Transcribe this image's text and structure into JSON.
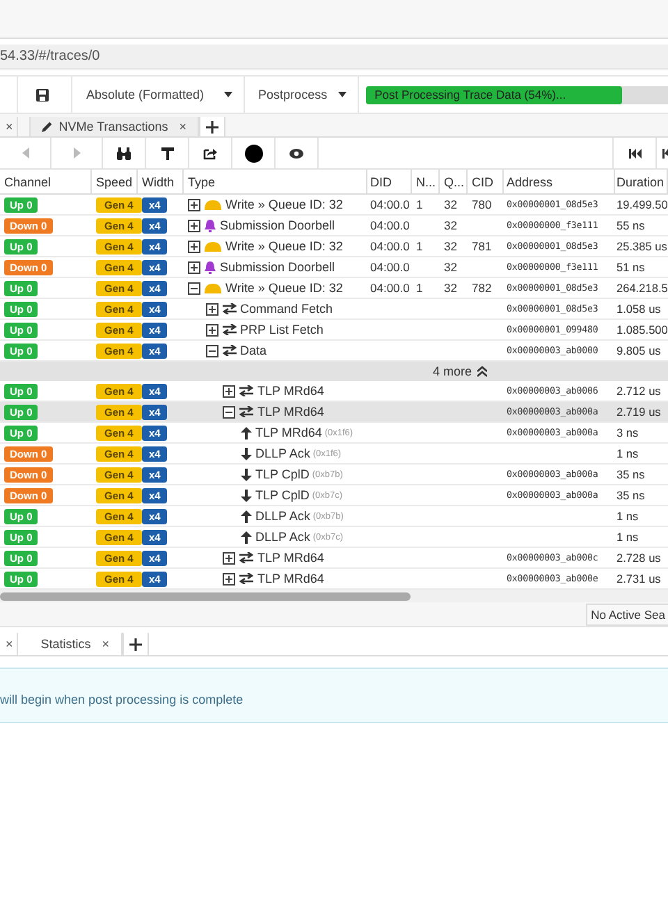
{
  "address_bar": {
    "url": "54.33/#/traces/0"
  },
  "toolbar": {
    "timestamp_format": "Absolute (Formatted)",
    "postprocess": "Postprocess",
    "progress": {
      "label": "Post Processing Trace Data (54%)...",
      "level": 0.54
    }
  },
  "tabs": [
    {
      "close": "×",
      "selected": false
    },
    {
      "label": "NVMe Transactions",
      "close": "×",
      "selected": true
    }
  ],
  "table": {
    "columns": [
      "Channel",
      "Speed",
      "Width",
      "Type",
      "DID",
      "N...",
      "Q...",
      "CID",
      "Address",
      "Duration"
    ],
    "rows": [
      {
        "kind": "command",
        "channel": "Up 0",
        "color": "#27b545",
        "speed": "Gen 4",
        "width": "x4",
        "type": "Write » Queue ID: 32",
        "expanded": false,
        "did": "04:00.0",
        "n": "1",
        "q": "32",
        "cid": "780",
        "address": "0x00000001_08d5e3",
        "duration": "19.499.50"
      },
      {
        "kind": "doorbell",
        "channel": "Down 0",
        "color": "#f07a22",
        "speed": "Gen 4",
        "width": "x4",
        "type": "Submission Doorbell",
        "expanded": false,
        "did": "04:00.0",
        "q": "32",
        "address": "0x00000000_f3e111",
        "duration": "55 ns"
      },
      {
        "kind": "command",
        "channel": "Up 0",
        "color": "#27b545",
        "speed": "Gen 4",
        "width": "x4",
        "type": "Write » Queue ID: 32",
        "expanded": false,
        "did": "04:00.0",
        "n": "1",
        "q": "32",
        "cid": "781",
        "address": "0x00000001_08d5e3",
        "duration": "25.385 us"
      },
      {
        "kind": "doorbell",
        "channel": "Down 0",
        "color": "#f07a22",
        "speed": "Gen 4",
        "width": "x4",
        "type": "Submission Doorbell",
        "expanded": false,
        "did": "04:00.0",
        "q": "32",
        "address": "0x00000000_f3e111",
        "duration": "51 ns"
      },
      {
        "kind": "command",
        "channel": "Up 0",
        "color": "#27b545",
        "speed": "Gen 4",
        "width": "x4",
        "type": "Write » Queue ID: 32",
        "expanded": true,
        "did": "04:00.0",
        "n": "1",
        "q": "32",
        "cid": "782",
        "address": "0x00000001_08d5e3",
        "duration": "264.218.5",
        "children": [
          {
            "kind": "transfer",
            "channel": "Up 0",
            "color": "#27b545",
            "speed": "Gen 4",
            "width": "x4",
            "type": "Command Fetch",
            "expanded": false,
            "address": "0x00000001_08d5e3",
            "duration": "1.058 us"
          },
          {
            "kind": "transfer",
            "channel": "Up 0",
            "color": "#27b545",
            "speed": "Gen 4",
            "width": "x4",
            "type": "PRP List Fetch",
            "expanded": false,
            "address": "0x00000001_099480",
            "duration": "1.085.500"
          },
          {
            "kind": "transfer",
            "channel": "Up 0",
            "color": "#27b545",
            "speed": "Gen 4",
            "width": "x4",
            "type": "Data",
            "expanded": true,
            "address": "0x00000003_ab0000",
            "duration": "9.805 us",
            "children": [
              {
                "kind": "more",
                "label": "4 more"
              },
              {
                "kind": "transfer",
                "channel": "Up 0",
                "color": "#27b545",
                "speed": "Gen 4",
                "width": "x4",
                "type": "TLP MRd64",
                "expanded": false,
                "address": "0x00000003_ab0006",
                "duration": "2.712 us"
              },
              {
                "kind": "transfer",
                "channel": "Up 0",
                "color": "#27b545",
                "speed": "Gen 4",
                "width": "x4",
                "type": "TLP MRd64",
                "expanded": true,
                "selected": true,
                "address": "0x00000003_ab000a",
                "duration": "2.719 us",
                "children": [
                  {
                    "kind": "up",
                    "channel": "Up 0",
                    "color": "#27b545",
                    "speed": "Gen 4",
                    "width": "x4",
                    "type": "TLP MRd64",
                    "note": "(0x1f6)",
                    "address": "0x00000003_ab000a",
                    "duration": "3 ns"
                  },
                  {
                    "kind": "down",
                    "channel": "Down 0",
                    "color": "#f07a22",
                    "speed": "Gen 4",
                    "width": "x4",
                    "type": "DLLP Ack",
                    "note": "(0x1f6)",
                    "duration": "1 ns"
                  },
                  {
                    "kind": "down",
                    "channel": "Down 0",
                    "color": "#f07a22",
                    "speed": "Gen 4",
                    "width": "x4",
                    "type": "TLP CplD",
                    "note": "(0xb7b)",
                    "address": "0x00000003_ab000a",
                    "duration": "35 ns"
                  },
                  {
                    "kind": "down",
                    "channel": "Down 0",
                    "color": "#f07a22",
                    "speed": "Gen 4",
                    "width": "x4",
                    "type": "TLP CplD",
                    "note": "(0xb7c)",
                    "address": "0x00000003_ab000a",
                    "duration": "35 ns"
                  },
                  {
                    "kind": "up",
                    "channel": "Up 0",
                    "color": "#27b545",
                    "speed": "Gen 4",
                    "width": "x4",
                    "type": "DLLP Ack",
                    "note": "(0xb7b)",
                    "duration": "1 ns"
                  },
                  {
                    "kind": "up",
                    "channel": "Up 0",
                    "color": "#27b545",
                    "speed": "Gen 4",
                    "width": "x4",
                    "type": "DLLP Ack",
                    "note": "(0xb7c)",
                    "duration": "1 ns"
                  }
                ]
              },
              {
                "kind": "transfer",
                "channel": "Up 0",
                "color": "#27b545",
                "speed": "Gen 4",
                "width": "x4",
                "type": "TLP MRd64",
                "expanded": false,
                "address": "0x00000003_ab000c",
                "duration": "2.728 us"
              },
              {
                "kind": "transfer",
                "channel": "Up 0",
                "color": "#27b545",
                "speed": "Gen 4",
                "width": "x4",
                "type": "TLP MRd64",
                "expanded": false,
                "address": "0x00000003_ab000e",
                "duration": "2.731 us"
              }
            ]
          }
        ]
      }
    ]
  },
  "status_bar": {
    "search": "No Active Sea"
  },
  "bottom_tabs": [
    {
      "close": "×",
      "selected": false
    },
    {
      "label": "Statistics",
      "close": "×",
      "selected": false
    }
  ],
  "info_panel": {
    "message": "will begin when post processing is complete"
  }
}
